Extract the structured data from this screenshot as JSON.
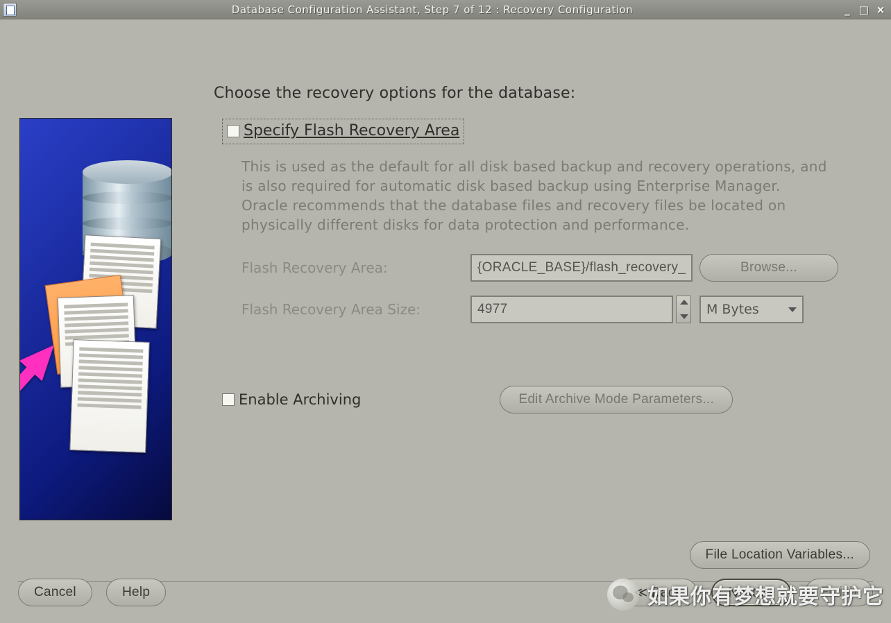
{
  "window": {
    "title": "Database Configuration Assistant, Step 7 of 12 : Recovery Configuration"
  },
  "heading": "Choose the recovery options for the database:",
  "specify_fra": {
    "label": "Specify Flash Recovery Area",
    "checked": false,
    "description": "This is used as the default for all disk based backup and recovery operations, and is also required for automatic disk based backup using Enterprise Manager. Oracle recommends that the database files and recovery files be located on physically different disks for data protection and performance."
  },
  "fields": {
    "fra_path_label": "Flash Recovery Area:",
    "fra_path_value": "{ORACLE_BASE}/flash_recovery_",
    "fra_size_label": "Flash Recovery Area Size:",
    "fra_size_value": "4977",
    "fra_size_unit": "M Bytes"
  },
  "buttons": {
    "browse": "Browse...",
    "edit_archive": "Edit Archive Mode Parameters...",
    "file_loc": "File Location Variables...",
    "cancel": "Cancel",
    "help": "Help",
    "back": "Back",
    "next": "Next",
    "finish": "Finish"
  },
  "archiving": {
    "label": "Enable Archiving",
    "checked": false
  },
  "overlay_text": "如果你有梦想就要守护它"
}
